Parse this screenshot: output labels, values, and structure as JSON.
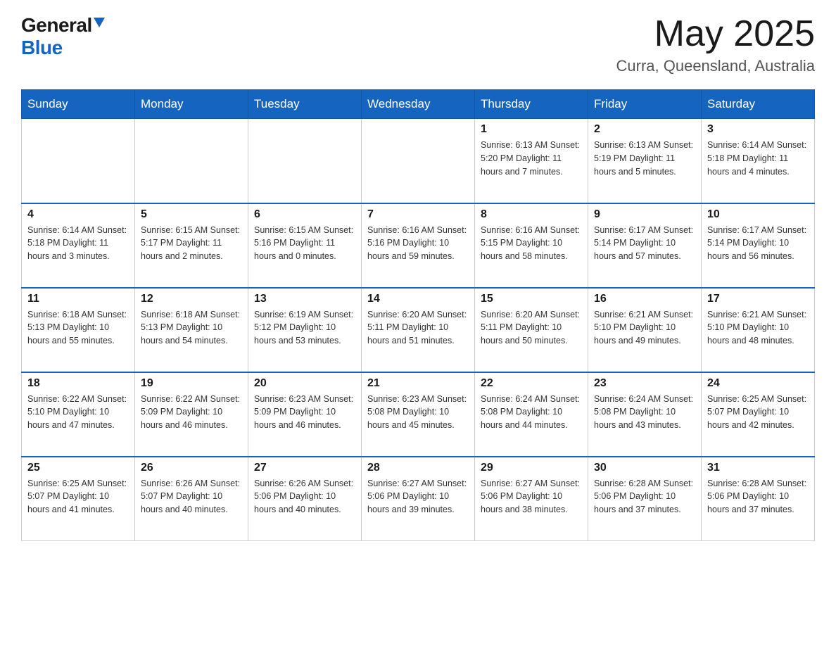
{
  "header": {
    "logo_general": "General",
    "logo_blue": "Blue",
    "month_title": "May 2025",
    "location": "Curra, Queensland, Australia"
  },
  "days_of_week": [
    "Sunday",
    "Monday",
    "Tuesday",
    "Wednesday",
    "Thursday",
    "Friday",
    "Saturday"
  ],
  "weeks": [
    [
      {
        "day": "",
        "info": ""
      },
      {
        "day": "",
        "info": ""
      },
      {
        "day": "",
        "info": ""
      },
      {
        "day": "",
        "info": ""
      },
      {
        "day": "1",
        "info": "Sunrise: 6:13 AM\nSunset: 5:20 PM\nDaylight: 11 hours and 7 minutes."
      },
      {
        "day": "2",
        "info": "Sunrise: 6:13 AM\nSunset: 5:19 PM\nDaylight: 11 hours and 5 minutes."
      },
      {
        "day": "3",
        "info": "Sunrise: 6:14 AM\nSunset: 5:18 PM\nDaylight: 11 hours and 4 minutes."
      }
    ],
    [
      {
        "day": "4",
        "info": "Sunrise: 6:14 AM\nSunset: 5:18 PM\nDaylight: 11 hours and 3 minutes."
      },
      {
        "day": "5",
        "info": "Sunrise: 6:15 AM\nSunset: 5:17 PM\nDaylight: 11 hours and 2 minutes."
      },
      {
        "day": "6",
        "info": "Sunrise: 6:15 AM\nSunset: 5:16 PM\nDaylight: 11 hours and 0 minutes."
      },
      {
        "day": "7",
        "info": "Sunrise: 6:16 AM\nSunset: 5:16 PM\nDaylight: 10 hours and 59 minutes."
      },
      {
        "day": "8",
        "info": "Sunrise: 6:16 AM\nSunset: 5:15 PM\nDaylight: 10 hours and 58 minutes."
      },
      {
        "day": "9",
        "info": "Sunrise: 6:17 AM\nSunset: 5:14 PM\nDaylight: 10 hours and 57 minutes."
      },
      {
        "day": "10",
        "info": "Sunrise: 6:17 AM\nSunset: 5:14 PM\nDaylight: 10 hours and 56 minutes."
      }
    ],
    [
      {
        "day": "11",
        "info": "Sunrise: 6:18 AM\nSunset: 5:13 PM\nDaylight: 10 hours and 55 minutes."
      },
      {
        "day": "12",
        "info": "Sunrise: 6:18 AM\nSunset: 5:13 PM\nDaylight: 10 hours and 54 minutes."
      },
      {
        "day": "13",
        "info": "Sunrise: 6:19 AM\nSunset: 5:12 PM\nDaylight: 10 hours and 53 minutes."
      },
      {
        "day": "14",
        "info": "Sunrise: 6:20 AM\nSunset: 5:11 PM\nDaylight: 10 hours and 51 minutes."
      },
      {
        "day": "15",
        "info": "Sunrise: 6:20 AM\nSunset: 5:11 PM\nDaylight: 10 hours and 50 minutes."
      },
      {
        "day": "16",
        "info": "Sunrise: 6:21 AM\nSunset: 5:10 PM\nDaylight: 10 hours and 49 minutes."
      },
      {
        "day": "17",
        "info": "Sunrise: 6:21 AM\nSunset: 5:10 PM\nDaylight: 10 hours and 48 minutes."
      }
    ],
    [
      {
        "day": "18",
        "info": "Sunrise: 6:22 AM\nSunset: 5:10 PM\nDaylight: 10 hours and 47 minutes."
      },
      {
        "day": "19",
        "info": "Sunrise: 6:22 AM\nSunset: 5:09 PM\nDaylight: 10 hours and 46 minutes."
      },
      {
        "day": "20",
        "info": "Sunrise: 6:23 AM\nSunset: 5:09 PM\nDaylight: 10 hours and 46 minutes."
      },
      {
        "day": "21",
        "info": "Sunrise: 6:23 AM\nSunset: 5:08 PM\nDaylight: 10 hours and 45 minutes."
      },
      {
        "day": "22",
        "info": "Sunrise: 6:24 AM\nSunset: 5:08 PM\nDaylight: 10 hours and 44 minutes."
      },
      {
        "day": "23",
        "info": "Sunrise: 6:24 AM\nSunset: 5:08 PM\nDaylight: 10 hours and 43 minutes."
      },
      {
        "day": "24",
        "info": "Sunrise: 6:25 AM\nSunset: 5:07 PM\nDaylight: 10 hours and 42 minutes."
      }
    ],
    [
      {
        "day": "25",
        "info": "Sunrise: 6:25 AM\nSunset: 5:07 PM\nDaylight: 10 hours and 41 minutes."
      },
      {
        "day": "26",
        "info": "Sunrise: 6:26 AM\nSunset: 5:07 PM\nDaylight: 10 hours and 40 minutes."
      },
      {
        "day": "27",
        "info": "Sunrise: 6:26 AM\nSunset: 5:06 PM\nDaylight: 10 hours and 40 minutes."
      },
      {
        "day": "28",
        "info": "Sunrise: 6:27 AM\nSunset: 5:06 PM\nDaylight: 10 hours and 39 minutes."
      },
      {
        "day": "29",
        "info": "Sunrise: 6:27 AM\nSunset: 5:06 PM\nDaylight: 10 hours and 38 minutes."
      },
      {
        "day": "30",
        "info": "Sunrise: 6:28 AM\nSunset: 5:06 PM\nDaylight: 10 hours and 37 minutes."
      },
      {
        "day": "31",
        "info": "Sunrise: 6:28 AM\nSunset: 5:06 PM\nDaylight: 10 hours and 37 minutes."
      }
    ]
  ]
}
